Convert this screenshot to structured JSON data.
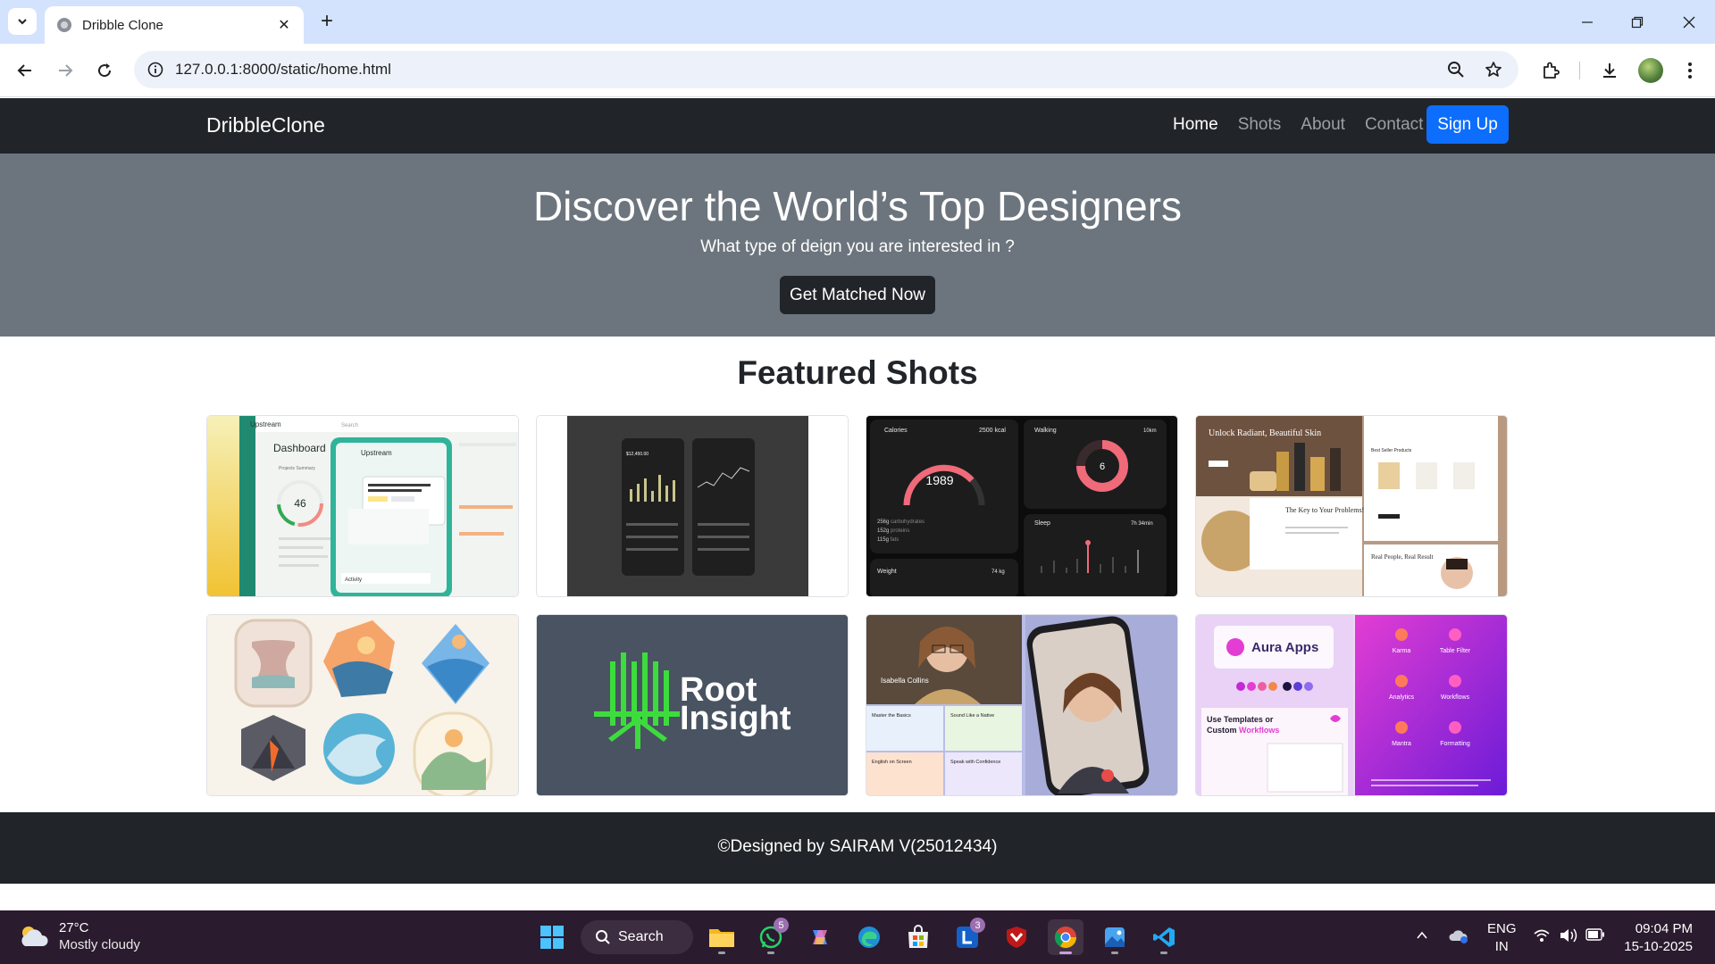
{
  "browser": {
    "tab_title": "Dribble Clone",
    "url": "127.0.0.1:8000/static/home.html"
  },
  "site": {
    "brand": "DribbleClone",
    "nav": [
      {
        "label": "Home",
        "active": true
      },
      {
        "label": "Shots",
        "active": false
      },
      {
        "label": "About",
        "active": false
      },
      {
        "label": "Contact",
        "active": false
      }
    ],
    "signup_label": "Sign Up",
    "hero": {
      "title": "Discover the World’s Top Designers",
      "subtitle": "What type of deign you are interested in ?",
      "cta": "Get Matched Now"
    },
    "featured_title": "Featured Shots",
    "shots": [
      {
        "name": "shot-upstream-dashboard",
        "texts": {
          "app": "Upstream",
          "search": "Search",
          "heading": "Dashboard",
          "summary": "Projects Summary",
          "value": "46",
          "popup_app": "Upstream",
          "activity": "Activity"
        }
      },
      {
        "name": "shot-dark-finance-app",
        "texts": {
          "amount": "$12,450.00"
        }
      },
      {
        "name": "shot-fitness-tracker",
        "texts": {
          "calories": "Calories",
          "kcal": "2500 kcal",
          "value": "1989",
          "walking": "Walking",
          "walk_km": "10km",
          "walk_val": "6",
          "sleep": "Sleep",
          "sleep_time": "7h 34min",
          "weight": "Weight",
          "weight_val": "74 kg",
          "carbs": "256g",
          "carbs_label": "carbohydrates",
          "protein": "152g",
          "protein_label": "proteins",
          "fats": "115g",
          "fats_label": "fats"
        }
      },
      {
        "name": "shot-skincare-landing",
        "texts": {
          "headline": "Unlock Radiant, Beautiful Skin",
          "key": "The Key to Your Problems!",
          "best": "Best Seller Products",
          "people": "Real People, Real Result"
        }
      },
      {
        "name": "shot-landscape-icons",
        "texts": {}
      },
      {
        "name": "shot-root-insight-logo",
        "texts": {
          "line1": "Root",
          "line2": "Insight"
        }
      },
      {
        "name": "shot-language-learning-app",
        "texts": {
          "person": "Isabella Collins",
          "c1": "Master the Basics",
          "c2": "Sound Like a Native",
          "c3": "English on Screen",
          "c4": "Speak with Confidence"
        }
      },
      {
        "name": "shot-aura-apps",
        "texts": {
          "brand": "Aura Apps",
          "templates": "Use Templates or",
          "custom": "Custom",
          "workflows": "Workflows",
          "k": "Karma",
          "tf": "Table Filter",
          "an": "Analytics",
          "wf": "Workflows",
          "mn": "Mantra",
          "fm": "Formatting"
        }
      }
    ],
    "footer": "©Designed by SAIRAM V(25012434)"
  },
  "taskbar": {
    "weather_temp": "27°C",
    "weather_cond": "Mostly cloudy",
    "search_label": "Search",
    "whatsapp_badge": "5",
    "l_badge": "3",
    "lang_1": "ENG",
    "lang_2": "IN",
    "time": "09:04 PM",
    "date": "15-10-2025"
  },
  "colors": {
    "navbar": "#212529",
    "hero": "#6c757d",
    "primary": "#0d6efd",
    "tabstrip": "#d3e3fd"
  }
}
